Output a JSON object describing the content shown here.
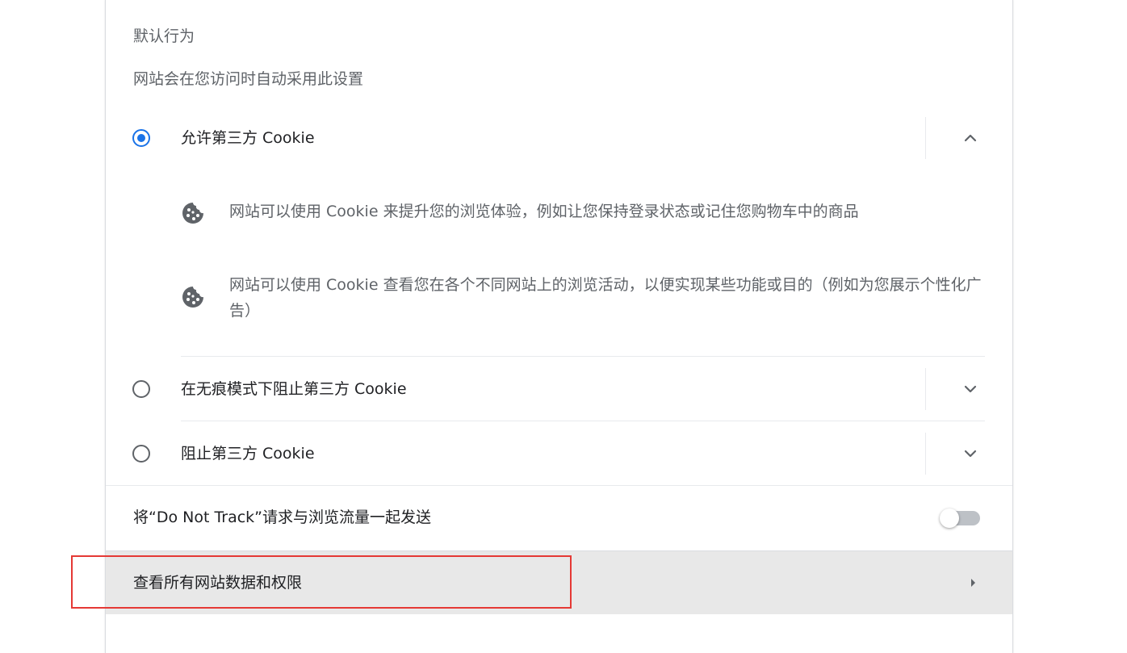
{
  "section": {
    "heading": "默认行为",
    "subtitle": "网站会在您访问时自动采用此设置"
  },
  "options": [
    {
      "label": "允许第三方 Cookie",
      "checked": true,
      "expanded": true,
      "chevron_icon": "chevron-up-icon"
    },
    {
      "label": "在无痕模式下阻止第三方 Cookie",
      "checked": false,
      "expanded": false,
      "chevron_icon": "chevron-down-icon"
    },
    {
      "label": "阻止第三方 Cookie",
      "checked": false,
      "expanded": false,
      "chevron_icon": "chevron-down-icon"
    }
  ],
  "details": [
    {
      "icon": "cookie-icon",
      "text": "网站可以使用 Cookie 来提升您的浏览体验，例如让您保持登录状态或记住您购物车中的商品"
    },
    {
      "icon": "cookie-icon",
      "text": "网站可以使用 Cookie 查看您在各个不同网站上的浏览活动，以便实现某些功能或目的（例如为您展示个性化广告）"
    }
  ],
  "do_not_track": {
    "label": "将“Do Not Track”请求与浏览流量一起发送",
    "enabled": false
  },
  "site_data": {
    "label": "查看所有网站数据和权限",
    "icon": "arrow-right-icon"
  },
  "colors": {
    "accent": "#1a73e8",
    "highlight_border": "#e53935",
    "hover_row": "#e8e8e8"
  }
}
